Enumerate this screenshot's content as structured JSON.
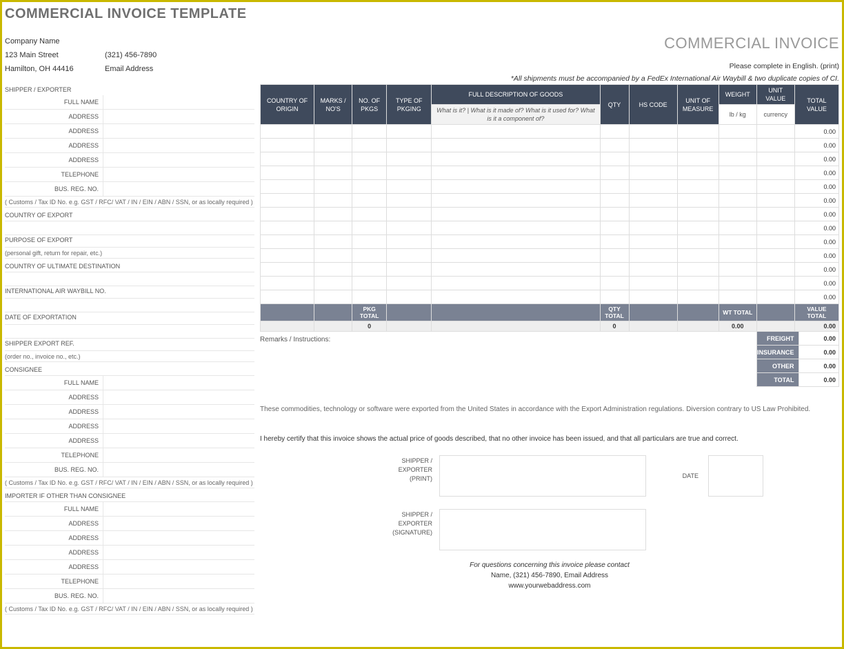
{
  "title": "COMMERCIAL INVOICE TEMPLATE",
  "header": {
    "company_name": "Company Name",
    "street": "123 Main Street",
    "phone": "(321) 456-7890",
    "city": "Hamilton, OH  44416",
    "email": "Email Address",
    "big": "COMMERCIAL INVOICE",
    "print_note": "Please complete in English. (print)",
    "ship_note": "*All shipments must be accompanied by a FedEx International Air Waybill & two duplicate copies of CI."
  },
  "left": {
    "shipper_exporter": "SHIPPER / EXPORTER",
    "full_name": "FULL NAME",
    "address": "ADDRESS",
    "telephone": "TELEPHONE",
    "bus_reg": "BUS. REG. NO.",
    "customs_note": "( Customs / Tax ID No. e.g. GST / RFC/ VAT / IN / EIN / ABN / SSN, or as locally required )",
    "country_export": "COUNTRY OF EXPORT",
    "purpose_export": "PURPOSE OF EXPORT",
    "purpose_hint": "(personal gift, return for repair, etc.)",
    "country_dest": "COUNTRY OF ULTIMATE DESTINATION",
    "air_waybill": "INTERNATIONAL AIR WAYBILL NO.",
    "date_export": "DATE OF EXPORTATION",
    "shipper_ref": "SHIPPER EXPORT REF.",
    "shipper_ref_hint": "(order no., invoice no., etc.)",
    "consignee": "CONSIGNEE",
    "importer": "IMPORTER IF OTHER THAN CONSIGNEE"
  },
  "goods": {
    "hdr_country": "COUNTRY OF ORIGIN",
    "hdr_marks": "MARKS / NO'S",
    "hdr_nopkgs": "NO. OF PKGS",
    "hdr_type": "TYPE OF PKGING",
    "hdr_desc": "FULL DESCRIPTION OF GOODS",
    "hdr_desc_sub": "What is it? | What is it made of? What is it used for? What is it a component of?",
    "hdr_qty": "QTY",
    "hdr_hs": "HS CODE",
    "hdr_uom": "UNIT OF MEASURE",
    "hdr_weight": "WEIGHT",
    "hdr_weight_sub": "lb / kg",
    "hdr_uvalue": "UNIT VALUE",
    "hdr_uvalue_sub": "currency",
    "hdr_total": "TOTAL VALUE",
    "zero": "0.00",
    "pkg_total": "PKG TOTAL",
    "qty_total": "QTY TOTAL",
    "wt_total": "WT TOTAL",
    "value_total": "VALUE TOTAL",
    "pkg_total_val": "0",
    "qty_total_val": "0",
    "wt_total_val": "0.00",
    "value_total_val": "0.00",
    "remarks": "Remarks / Instructions:"
  },
  "summary": {
    "freight": "FREIGHT",
    "insurance": "INSURANCE",
    "other": "OTHER",
    "total": "TOTAL",
    "val": "0.00"
  },
  "legal": "These commodities, technology or software were exported from the United States in accordance with the Export Administration regulations.  Diversion contrary to US Law Prohibited.",
  "cert": "I hereby certify that this invoice shows the actual price of goods described, that no other invoice has been issued, and that all particulars are true and correct.",
  "sig": {
    "print": "SHIPPER / EXPORTER (PRINT)",
    "date": "DATE",
    "signature": "SHIPPER / EXPORTER (SIGNATURE)"
  },
  "contact": {
    "q": "For questions concerning this invoice please contact",
    "info": "Name, (321) 456-7890, Email Address",
    "web": "www.yourwebaddress.com"
  }
}
